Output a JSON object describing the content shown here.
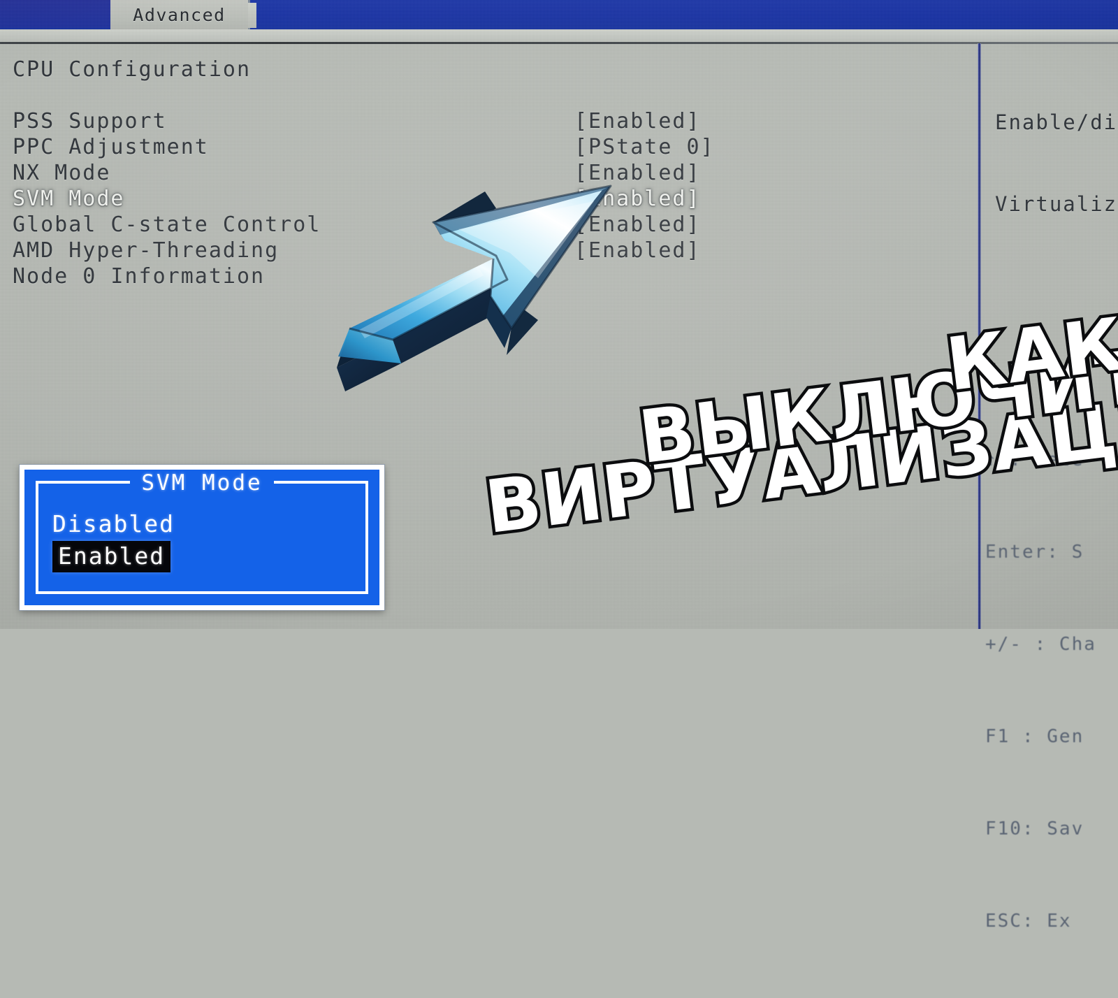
{
  "screen": {
    "background_color": "#b6bab4",
    "topbar_color": "#1630a4"
  },
  "topbar": {
    "active_tab": "Advanced"
  },
  "main": {
    "section_title": "CPU Configuration",
    "settings": [
      {
        "label": "PSS Support",
        "value": "[Enabled]",
        "selected": false
      },
      {
        "label": "PPC Adjustment",
        "value": "[PState 0]",
        "selected": false
      },
      {
        "label": "NX Mode",
        "value": "[Enabled]",
        "selected": false
      },
      {
        "label": "SVM Mode",
        "value": "[Enabled]",
        "selected": true
      },
      {
        "label": "Global C-state Control",
        "value": "[Enabled]",
        "selected": false
      },
      {
        "label": "AMD Hyper-Threading",
        "value": "[Enabled]",
        "selected": false
      },
      {
        "label": "Node 0 Information",
        "value": "",
        "selected": false
      }
    ]
  },
  "help_pane": {
    "lines": [
      "Enable/di",
      "Virtualiz"
    ],
    "key_legend": [
      "↑↓: Sele",
      "Enter: S",
      "+/- : Cha",
      "F1 : Gen",
      "F10: Sav",
      "ESC: Ex"
    ]
  },
  "popup": {
    "title": "SVM Mode",
    "options": [
      {
        "label": "Disabled",
        "highlighted": false
      },
      {
        "label": "Enabled",
        "highlighted": true
      }
    ],
    "fill_color": "#1462e8",
    "border_color": "#ffffff",
    "highlight_color": "#05060a"
  },
  "annotations": {
    "arrow": {
      "name": "pointer-arrow",
      "light_color": "#9fdcf5",
      "mid_color": "#2a9fd8",
      "dark_color": "#15314f",
      "points_to": "SVM Mode value"
    },
    "caption": {
      "line1": "КАК",
      "line2": "ВЫКЛЮЧИТЬ",
      "line3": "ВИРТУАЛИЗАЦИЮ?",
      "fill_color": "#ffffff",
      "outline_color": "#0b0c0e"
    }
  }
}
